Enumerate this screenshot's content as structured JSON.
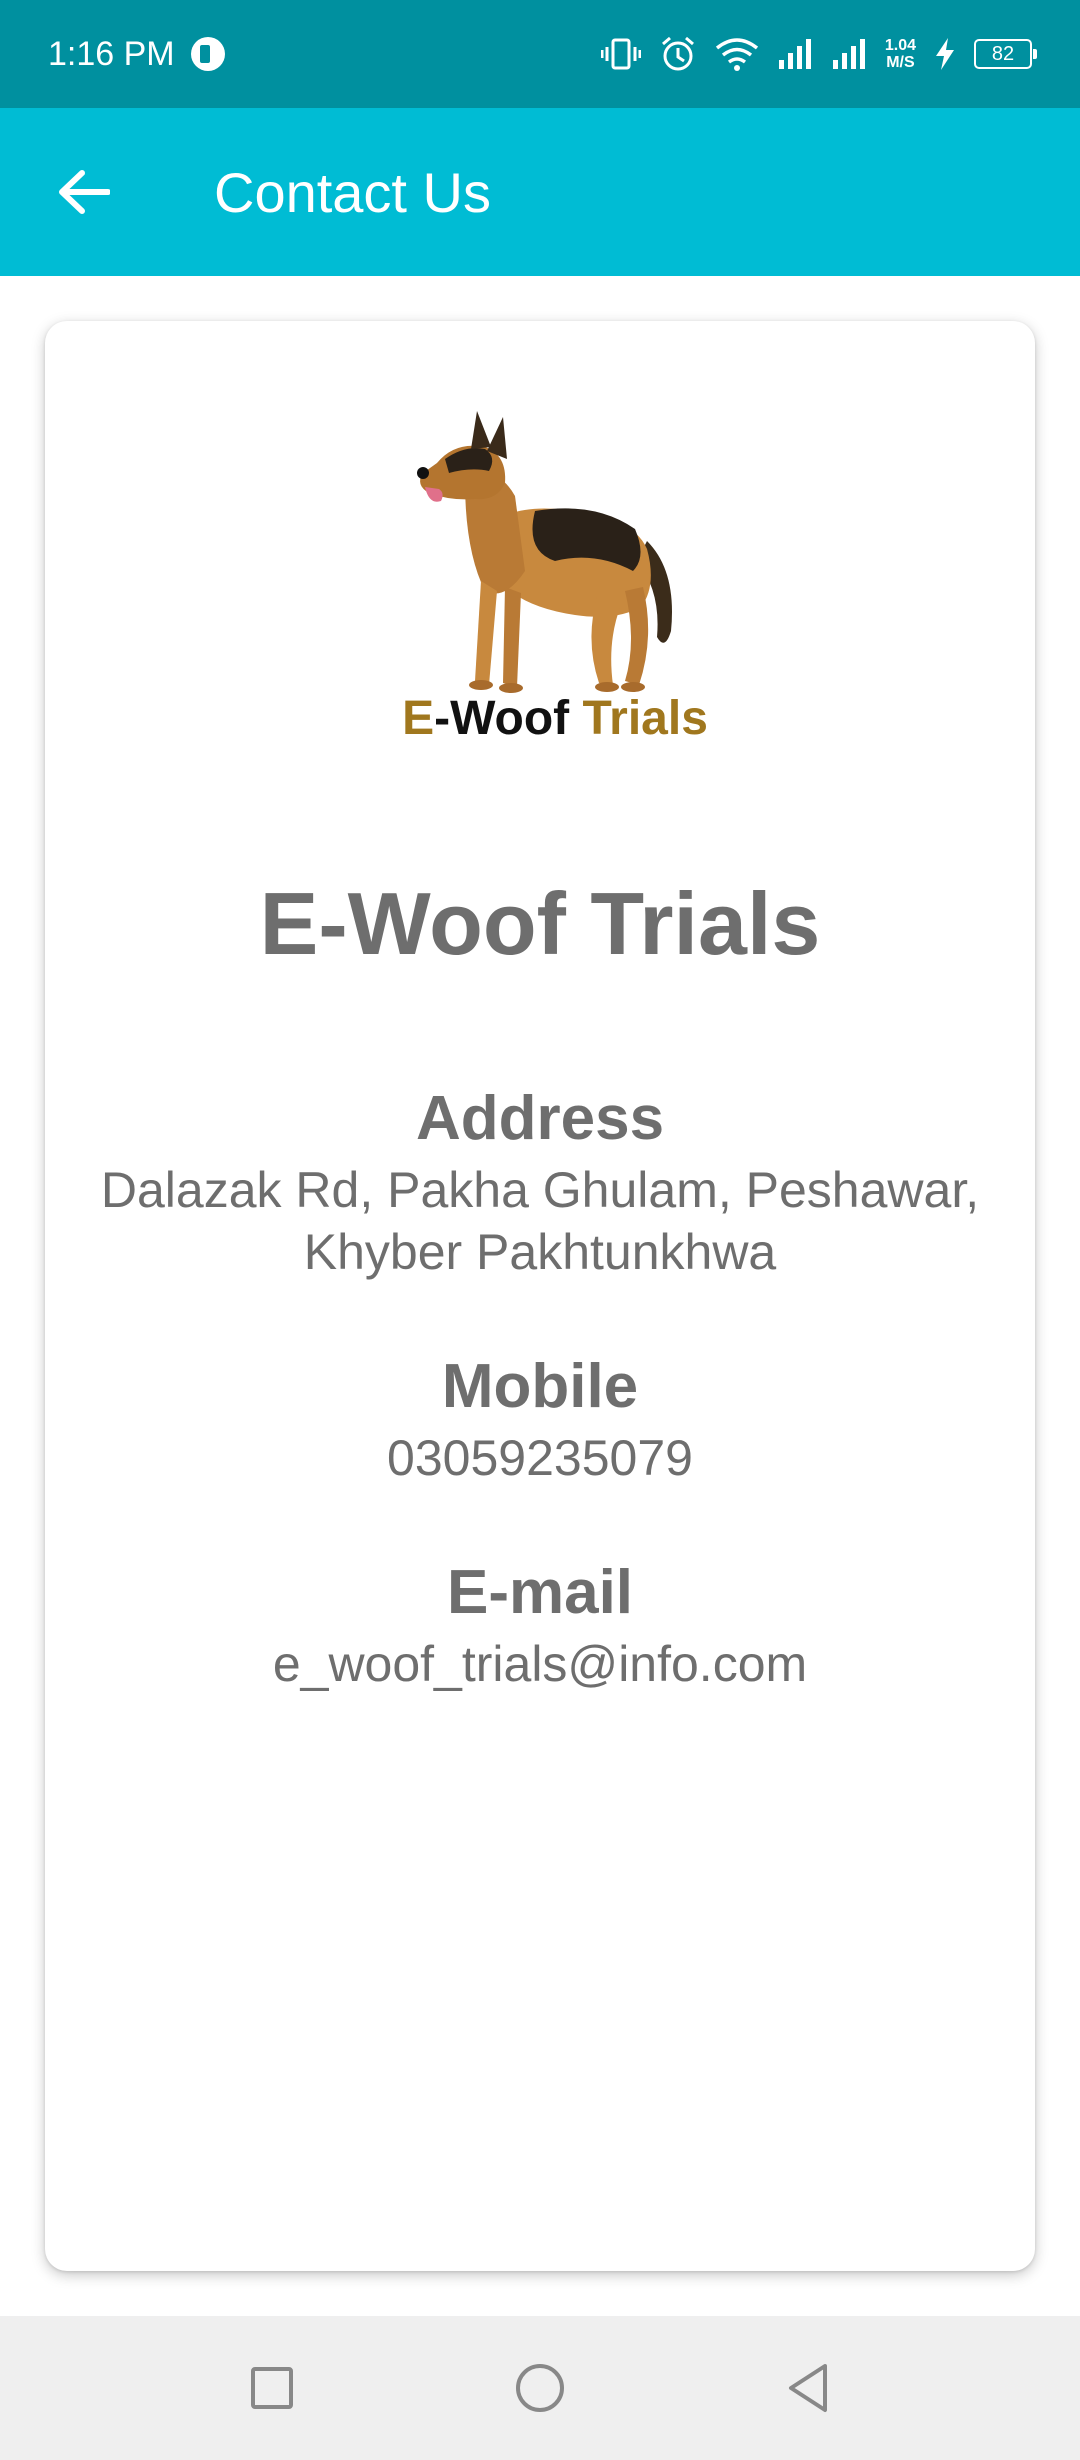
{
  "status_bar": {
    "time": "1:16 PM",
    "net_speed_value": "1.04",
    "net_speed_unit": "M/S",
    "battery": "82"
  },
  "app_bar": {
    "title": "Contact Us",
    "back_icon": "arrow-left-icon"
  },
  "logo": {
    "text_part1": "E",
    "text_part2": "-Woof ",
    "text_part3": "Trials"
  },
  "contact": {
    "company_name": "E-Woof Trials",
    "address_label": "Address",
    "address_line1": "Dalazak Rd, Pakha Ghulam, Peshawar,",
    "address_line2": "Khyber Pakhtunkhwa",
    "mobile_label": "Mobile",
    "mobile_value": "03059235079",
    "email_label": "E-mail",
    "email_value": "e_woof_trials@info.com"
  },
  "nav_bar": {
    "items": [
      "recents-icon",
      "home-icon",
      "back-triangle-icon"
    ]
  },
  "colors": {
    "status_bar": "#00909f",
    "app_bar": "#00bcd4",
    "text_gray": "#6e6e6e",
    "logo_gold": "#a0771e"
  }
}
